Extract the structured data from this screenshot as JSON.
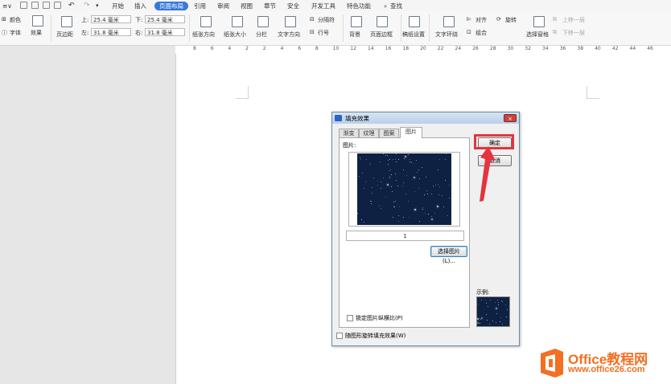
{
  "toolbar": {
    "tabs": [
      "开始",
      "插入",
      "页面布局",
      "引用",
      "审阅",
      "视图",
      "章节",
      "安全",
      "开发工具",
      "特色功能",
      "查找"
    ],
    "active_tab": "页面布局"
  },
  "ribbon": {
    "color_label": "颜色",
    "font_label": "字体",
    "effect_label": "效果",
    "margin_label": "页边距",
    "top_label": "上:",
    "bottom_label": "下:",
    "left_label": "左:",
    "right_label": "右:",
    "top_value": "25.4 毫米",
    "bottom_value": "25.4 毫米",
    "left_value": "31.8 毫米",
    "right_value": "31.8 毫米",
    "orientation_label": "纸张方向",
    "size_label": "纸张大小",
    "columns_label": "分栏",
    "text_dir_label": "文字方向",
    "separator_label": "分隔符",
    "line_num_label": "行号",
    "background_label": "背景",
    "border_label": "页面边框",
    "page_setup_label": "稿纸设置",
    "wrap_label": "文字环绕",
    "align_label": "对齐",
    "rotate_label": "旋转",
    "group_label": "组合",
    "select_pane_label": "选择窗格",
    "up_label": "上移一层",
    "down_label": "下移一层"
  },
  "ruler": {
    "marks": [
      "8",
      "6",
      "4",
      "2",
      "2",
      "4",
      "6",
      "8",
      "10",
      "12",
      "14",
      "16",
      "18",
      "20",
      "22",
      "24",
      "26",
      "28",
      "30",
      "32",
      "34",
      "36",
      "38",
      "40",
      "42",
      "44",
      "46"
    ]
  },
  "dialog": {
    "title": "填充效果",
    "close": "×",
    "tabs": [
      "渐变",
      "纹理",
      "图案",
      "图片"
    ],
    "active_tab": "图片",
    "picture_label": "图片:",
    "page_number": "1",
    "select_picture": "选择图片(L)...",
    "lock_ratio": "锁定图片纵横比(P)",
    "rotate_fill": "随图形旋转填充效果(W)",
    "ok": "确定",
    "cancel": "取消",
    "sample_label": "示例:"
  },
  "watermark": {
    "line1": "Office教程网",
    "line2": "www.office26.com"
  },
  "colors": {
    "accent": "#3a78d8",
    "highlight": "#e3343f",
    "sky": "#0f2142",
    "watermark": "#f36f21"
  }
}
